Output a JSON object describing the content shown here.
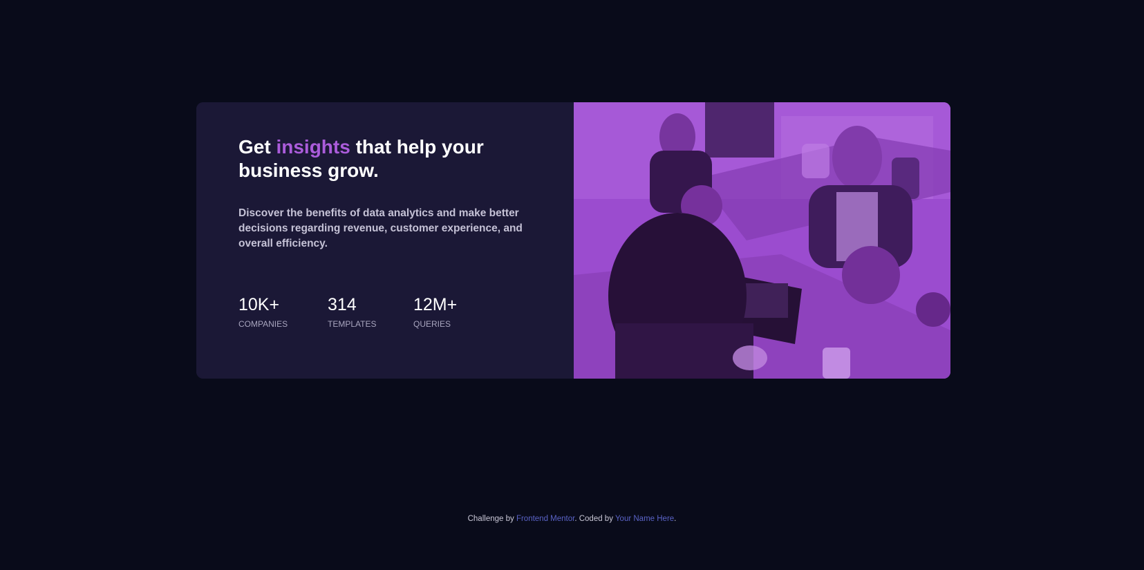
{
  "card": {
    "headline": {
      "before": "Get ",
      "accent": "insights",
      "after": " that help your business grow."
    },
    "description": "Discover the benefits of data analytics and make better decisions regarding revenue, customer experience, and overall efficiency.",
    "stats": [
      {
        "value": "10K+",
        "label": "COMPANIES"
      },
      {
        "value": "314",
        "label": "TEMPLATES"
      },
      {
        "value": "12M+",
        "label": "QUERIES"
      }
    ],
    "image_alt": "people-working-in-office-photo"
  },
  "footer": {
    "prefix": "Challenge by ",
    "link1": "Frontend Mentor",
    "middle": ". Coded by ",
    "link2": "Your Name Here",
    "suffix": "."
  },
  "colors": {
    "background": "#090b1a",
    "card": "#1b1836",
    "accent": "#ab5cdb",
    "image_tint": "#8f45bf",
    "link": "#5a63c6"
  }
}
